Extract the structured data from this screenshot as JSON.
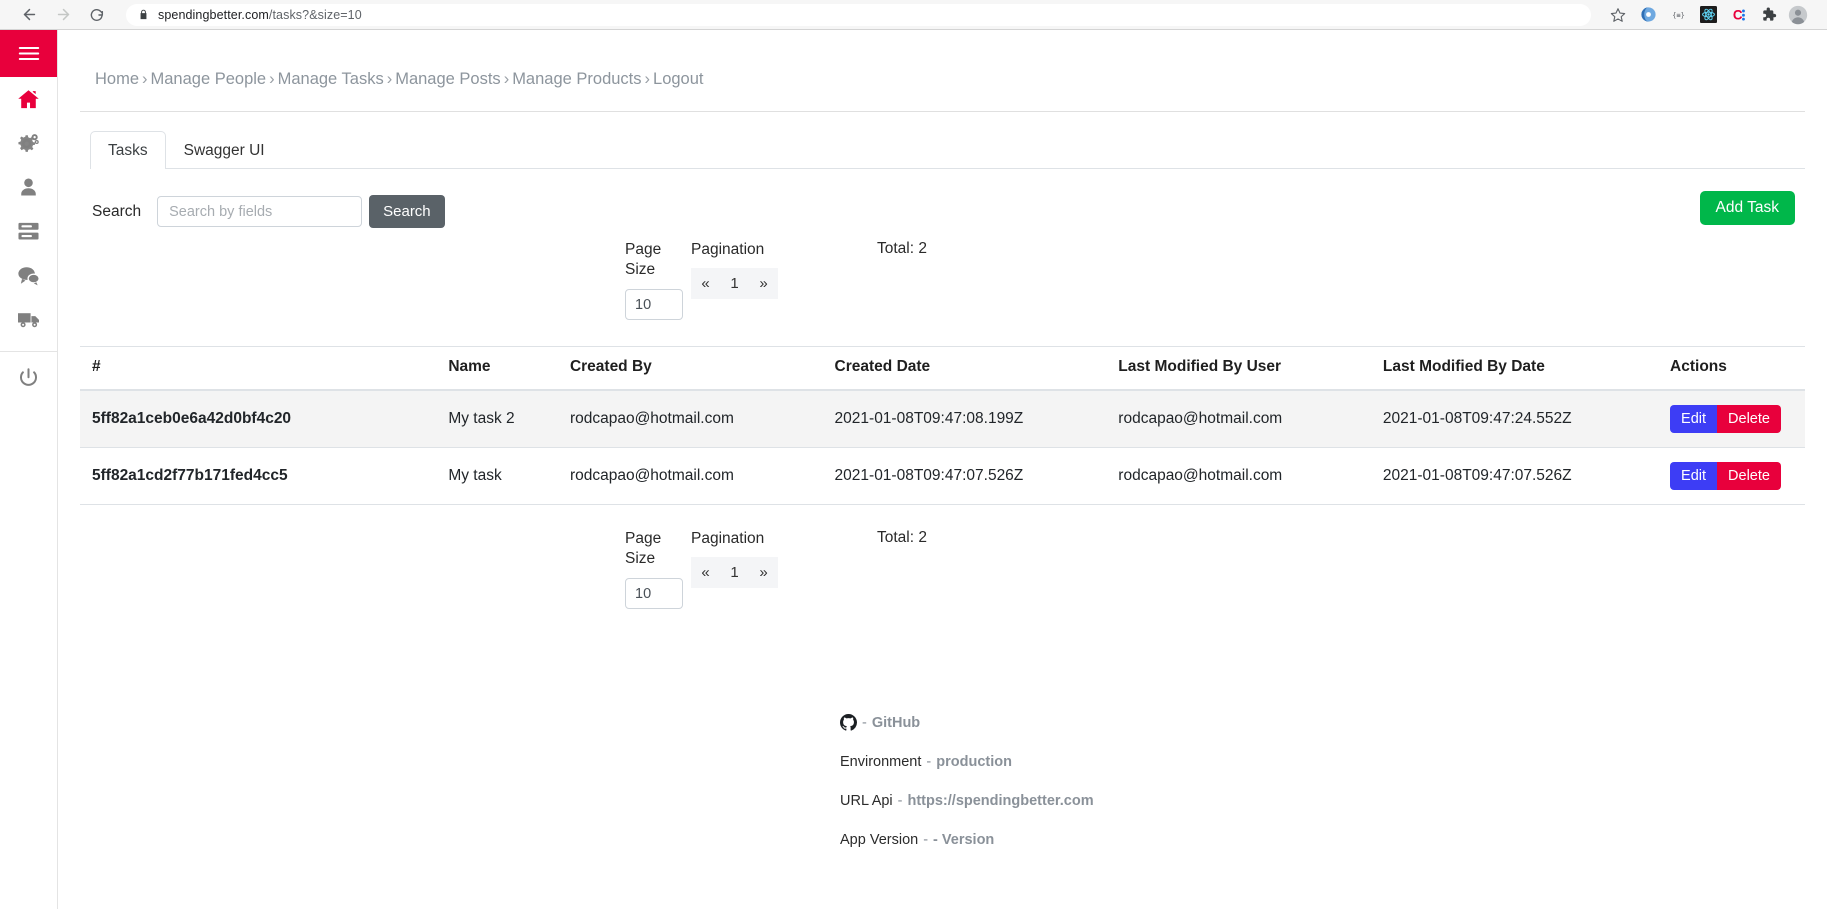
{
  "browser": {
    "back_icon": "arrow-left-icon",
    "forward_icon": "arrow-right-icon",
    "reload_icon": "reload-icon",
    "lock_icon": "lock-icon",
    "url_domain": "spendingbetter.com",
    "url_path": "/tasks?&size=10",
    "bookmark_icon": "star-icon",
    "extensions": [
      {
        "name": "browser-extension-blue-circle"
      },
      {
        "name": "browser-extension-brackets"
      },
      {
        "name": "browser-extension-react-devtools"
      },
      {
        "name": "browser-extension-c-letter"
      },
      {
        "name": "browser-extensions-puzzle-icon"
      },
      {
        "name": "browser-profile-avatar"
      }
    ]
  },
  "sidebar": {
    "toggle_icon": "hamburger-menu-icon",
    "items": [
      {
        "icon": "home-icon",
        "name": "sidebar-item-home"
      },
      {
        "icon": "gears-icon",
        "name": "sidebar-item-settings"
      },
      {
        "icon": "user-icon",
        "name": "sidebar-item-people"
      },
      {
        "icon": "server-list-icon",
        "name": "sidebar-item-tasks"
      },
      {
        "icon": "comments-icon",
        "name": "sidebar-item-posts"
      },
      {
        "icon": "truck-icon",
        "name": "sidebar-item-products"
      }
    ],
    "power_icon": "power-icon"
  },
  "breadcrumb": {
    "separator": "›",
    "items": [
      "Home",
      "Manage People",
      "Manage Tasks",
      "Manage Posts",
      "Manage Products",
      "Logout"
    ]
  },
  "tabs": [
    {
      "label": "Tasks",
      "active": true
    },
    {
      "label": "Swagger UI",
      "active": false
    }
  ],
  "search": {
    "label": "Search",
    "placeholder": "Search by fields",
    "value": "",
    "button_label": "Search"
  },
  "actions": {
    "add_label": "Add Task",
    "add_color": "#00b74a",
    "edit_label": "Edit",
    "edit_color": "#3d3df5",
    "delete_label": "Delete",
    "delete_color": "#e8003c"
  },
  "pagination": {
    "page_size_label": "Page Size",
    "page_size_value": "10",
    "pagination_label": "Pagination",
    "prev_label": "«",
    "page_label": "1",
    "next_label": "»",
    "total_label": "Total: 2"
  },
  "table": {
    "columns": [
      "#",
      "Name",
      "Created By",
      "Created Date",
      "Last Modified By User",
      "Last Modified By Date",
      "Actions"
    ],
    "rows": [
      {
        "id": "5ff82a1ceb0e6a42d0bf4c20",
        "name": "My task 2",
        "created_by": "rodcapao@hotmail.com",
        "created_date": "2021-01-08T09:47:08.199Z",
        "modified_by": "rodcapao@hotmail.com",
        "modified_date": "2021-01-08T09:47:24.552Z"
      },
      {
        "id": "5ff82a1cd2f77b171fed4cc5",
        "name": "My task",
        "created_by": "rodcapao@hotmail.com",
        "created_date": "2021-01-08T09:47:07.526Z",
        "modified_by": "rodcapao@hotmail.com",
        "modified_date": "2021-01-08T09:47:07.526Z"
      }
    ]
  },
  "footer": {
    "github_icon": "github-icon",
    "github_dash": "-",
    "github_label": "GitHub",
    "env_label": "Environment",
    "env_dash": "-",
    "env_value": "production",
    "api_label": "URL Api",
    "api_dash": "-",
    "api_value": "https://spendingbetter.com",
    "version_label": "App Version",
    "version_dash": "-",
    "version_value": "- Version"
  }
}
